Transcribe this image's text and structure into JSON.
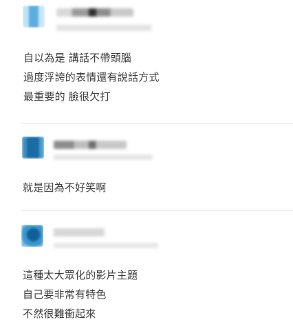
{
  "comments": [
    {
      "lines": [
        "自以為是 講話不帶頭腦",
        "過度浮誇的表情還有說話方式",
        "最重要的 臉很欠打"
      ]
    },
    {
      "lines": [
        "就是因為不好笑啊"
      ]
    },
    {
      "lines": [
        "這種太大眾化的影片主題",
        "自己要非常有特色",
        "不然很難衝起來"
      ]
    }
  ]
}
